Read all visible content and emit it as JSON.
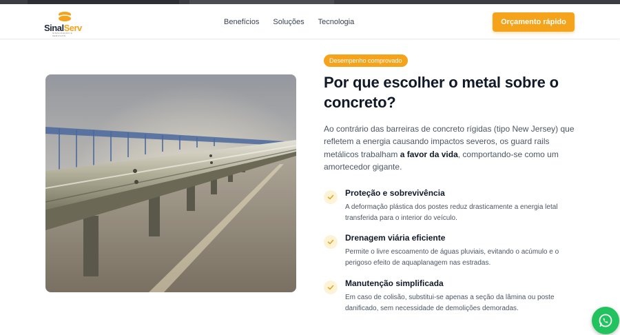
{
  "brand": {
    "name_part1": "Sinal",
    "name_part2": "Serv",
    "tagline": "SINALIZAÇÃO E SERVIÇOS"
  },
  "nav": {
    "items": [
      "Benefícios",
      "Soluções",
      "Tecnologia"
    ]
  },
  "header": {
    "cta_label": "Orçamento rápido"
  },
  "section": {
    "badge": "Desempenho comprovado",
    "title": "Por que escolher o metal sobre o concreto?",
    "lead_before": "Ao contrário das barreiras de concreto rígidas (tipo New Jersey) que refletem a energia causando impactos severos, os guard rails metálicos trabalham ",
    "lead_bold": "a favor da vida",
    "lead_after": ", comportando-se como um amortecedor gigante.",
    "image_subject": "metal guard rail on foggy bridge"
  },
  "features": [
    {
      "title": "Proteção e sobrevivência",
      "desc": "A deformação plástica dos postes reduz drasticamente a energia letal transferida para o interior do veículo."
    },
    {
      "title": "Drenagem viária eficiente",
      "desc": "Permite o livre escoamento de águas pluviais, evitando o acúmulo e o perigoso efeito de aquaplanagem nas estradas."
    },
    {
      "title": "Manutenção simplificada",
      "desc": "Em caso de colisão, substitui-se apenas a seção da lâmina ou poste danificado, sem necessidade de demolições demoradas."
    }
  ],
  "icons": {
    "feature": "check-icon",
    "float": "whatsapp-icon"
  },
  "colors": {
    "accent": "#f5a31a",
    "check_bg": "#fdf3d6",
    "whatsapp": "#22c35e",
    "text_dark": "#111827",
    "text_body": "#4b5563"
  }
}
